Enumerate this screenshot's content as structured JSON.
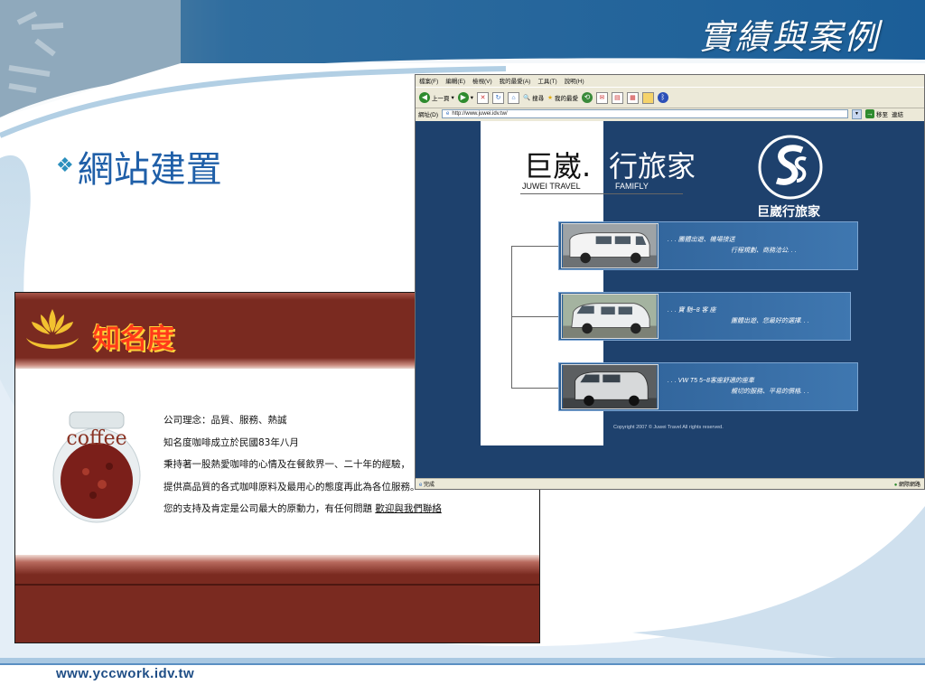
{
  "slide": {
    "title": "實績與案例",
    "bullet": "網站建置",
    "footer_url": "www.yccwork.idv.tw"
  },
  "coffee_site": {
    "brand": "知名度",
    "jar_label": "coffee",
    "lines": [
      "公司理念：品質、服務、熱誠",
      "知名度咖啡成立於民國83年八月",
      "秉持著一股熱愛咖啡的心情及在餐飲界一、二十年的經驗，",
      "提供高品質的各式咖啡原料及最用心的態度再此為各位服務。"
    ],
    "last_line": "您的支持及肯定是公司最大的原動力，有任何問題",
    "contact_link": "歡迎與我們聯絡"
  },
  "browser": {
    "menu": [
      "檔案(F)",
      "編輯(E)",
      "檢視(V)",
      "我的最愛(A)",
      "工具(T)",
      "說明(H)"
    ],
    "back_label": "上一頁",
    "search_label": "搜尋",
    "favorites_label": "我的最愛",
    "address_label": "網址(D)",
    "address_value": "http://www.juwei.idv.tw/",
    "go_label": "移至",
    "links_label": "連結",
    "status_left": "完成",
    "status_right": "網際網路"
  },
  "juwei_site": {
    "name_cn_left": "巨崴.",
    "name_cn_right": "行旅家",
    "name_en_left": "JUWEI TRAVEL",
    "name_en_right": "FAMIFLY",
    "brand_name": "巨崴行旅家",
    "cards": [
      {
        "line1": ". . . 團體出遊、機場接送",
        "line2": "行程規劃、商務洽公. . ."
      },
      {
        "line1": ". . . 寶 馳~8 客 座",
        "line2": "團體出遊、您最好的選擇. . ."
      },
      {
        "line1": ". . . VW  T5 5~8客座舒適的座車",
        "line2": "親切的服務、平易的價格. . ."
      }
    ],
    "copyright": "Copyright 2007 © Juwei Travel All rights reserved."
  },
  "colors": {
    "accent_blue": "#1f5fa8",
    "header_blue": "#1e416d",
    "coffee_red": "#7a2a20"
  }
}
